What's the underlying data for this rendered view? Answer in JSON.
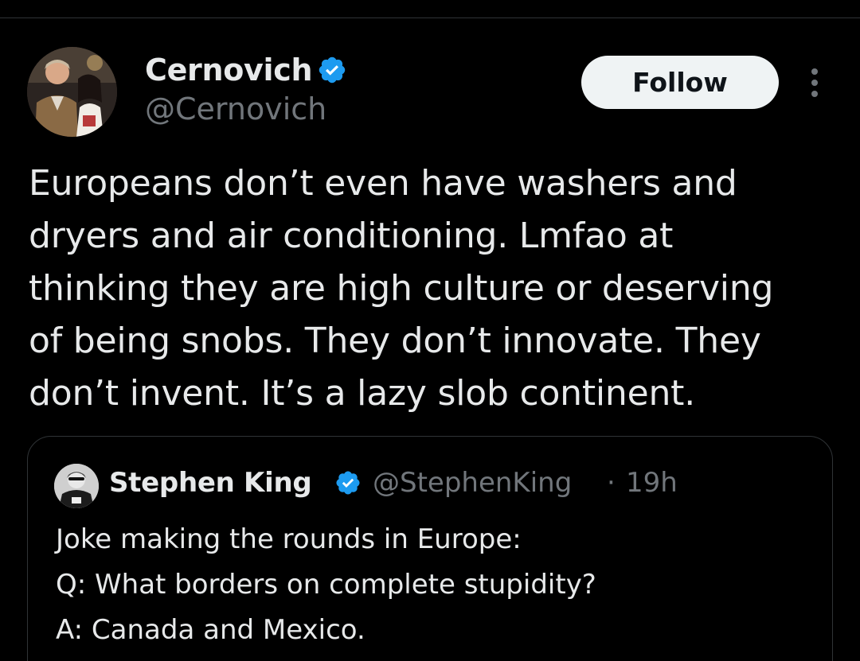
{
  "tweet": {
    "author": {
      "display_name": "Cernovich",
      "handle": "@Cernovich",
      "verified": true
    },
    "follow_label": "Follow",
    "more_icon": "more-vertical-icon",
    "text_lines": [
      "Europeans don’t even have washers and",
      "dryers and air conditioning. Lmfao at",
      "thinking they are high culture or deserving",
      "of being snobs. They don’t innovate. They",
      "don’t invent. It’s a lazy slob continent."
    ]
  },
  "quote": {
    "author": {
      "display_name": "Stephen King",
      "handle": "@StephenKing",
      "verified": true
    },
    "separator": "·",
    "time": "19h",
    "text_lines": [
      "Joke making the rounds in Europe:",
      "Q: What borders on complete stupidity?",
      "A: Canada and Mexico."
    ]
  },
  "colors": {
    "background": "#000000",
    "text_primary": "#e7e9ea",
    "text_secondary": "#71767b",
    "verified_blue": "#1d9bf0",
    "border": "#2f3336",
    "follow_bg": "#eff3f4"
  }
}
